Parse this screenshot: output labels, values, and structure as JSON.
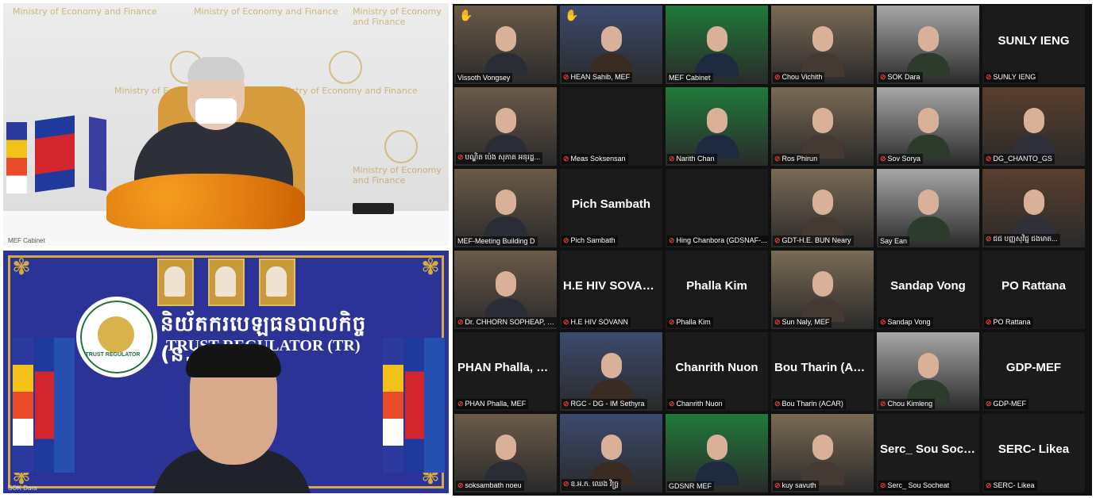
{
  "left_panels": {
    "top": {
      "watermark": "Ministry of Economy and Finance",
      "label": "MEF Cabinet"
    },
    "bottom": {
      "title_khmer": "និយ័តករបេឡធនបាលកិច្ច (ន.ប.ធ.)",
      "title_english": "TRUST REGULATOR (TR)",
      "logo_text": "TRUST REGULATOR",
      "label": "SOK Dara"
    }
  },
  "grid": {
    "tiles": [
      {
        "label": "Vissoth Vongsey",
        "video": true,
        "active": true,
        "raised_hand": true,
        "muted": false
      },
      {
        "label": "HEAN Sahib, MEF",
        "video": true,
        "raised_hand": true,
        "muted": true
      },
      {
        "label": "MEF Cabinet",
        "video": true,
        "muted": false
      },
      {
        "label": "Chou Vichith",
        "video": true,
        "muted": true
      },
      {
        "label": "SOK Dara",
        "video": true,
        "muted": true
      },
      {
        "label": "SUNLY IENG",
        "name_display": "SUNLY IENG",
        "muted": true
      },
      {
        "label": "បណ្ឌិត ប៉េង សុភាគ អនុរដ្ឋ...",
        "video": true,
        "muted": true
      },
      {
        "label": "Meas Soksensan",
        "muted": true
      },
      {
        "label": "Narith Chan",
        "video": true,
        "muted": true
      },
      {
        "label": "Ros Phirun",
        "video": true,
        "muted": true
      },
      {
        "label": "Sov Sorya",
        "video": true,
        "muted": true
      },
      {
        "label": "DG_CHANTO_GS",
        "video": true,
        "muted": true
      },
      {
        "label": "MEF-Meeting Building D",
        "video": true,
        "muted": false
      },
      {
        "label": "Pich Sambath",
        "name_display": "Pich Sambath",
        "muted": true
      },
      {
        "label": "Hing Chanbora (GDSNAF-...",
        "muted": true
      },
      {
        "label": "GDT-H.E. BUN Neary",
        "video": true,
        "muted": true
      },
      {
        "label": "Say Ean",
        "video": true,
        "muted": false
      },
      {
        "label": "ជជ បញ្ញសុវិជ្ជ ជងមាត...",
        "video": true,
        "muted": true
      },
      {
        "label": "Dr. CHHORN SOPHEAP, MEF",
        "video": true,
        "muted": true
      },
      {
        "label": "H.E HIV SOVANN",
        "name_display": "H.E HIV SOVANN",
        "muted": true
      },
      {
        "label": "Phalla Kim",
        "name_display": "Phalla Kim",
        "muted": true
      },
      {
        "label": "Sun Naly, MEF",
        "video": true,
        "muted": true
      },
      {
        "label": "Sandap Vong",
        "name_display": "Sandap Vong",
        "muted": true
      },
      {
        "label": "PO Rattana",
        "name_display": "PO Rattana",
        "muted": true
      },
      {
        "label": "PHAN Phalla, MEF",
        "name_display": "PHAN Phalla, MEF",
        "muted": true
      },
      {
        "label": "RGC - DG - IM Sethyra",
        "video": true,
        "muted": true
      },
      {
        "label": "Chanrith Nuon",
        "name_display": "Chanrith Nuon",
        "muted": true
      },
      {
        "label": "Bou Tharin (ACAR)",
        "name_display": "Bou Tharin (AC...",
        "muted": true
      },
      {
        "label": "Chou Kimleng",
        "video": true,
        "muted": true
      },
      {
        "label": "GDP-MEF",
        "name_display": "GDP-MEF",
        "muted": true
      },
      {
        "label": "soksambath noeu",
        "video": true,
        "muted": true
      },
      {
        "label": "ឧ.អ.ក. ឈេង វិច្ឆ្រ",
        "video": true,
        "muted": true
      },
      {
        "label": "GDSNR MEF",
        "video": true,
        "muted": false
      },
      {
        "label": "kuy savuth",
        "video": true,
        "muted": true
      },
      {
        "label": "Serc_ Sou Socheat",
        "name_display": "Serc_ Sou Socheat",
        "muted": true
      },
      {
        "label": "SERC- Likea",
        "name_display": "SERC- Likea",
        "muted": true
      }
    ]
  },
  "icons": {
    "muted": "muted-mic-icon",
    "hand": "raised-hand-icon"
  },
  "colors": {
    "accent_active": "#c6e34a",
    "muted": "#e03a3a",
    "tr_blue": "#2b3496",
    "gold": "#d5aa3f"
  }
}
